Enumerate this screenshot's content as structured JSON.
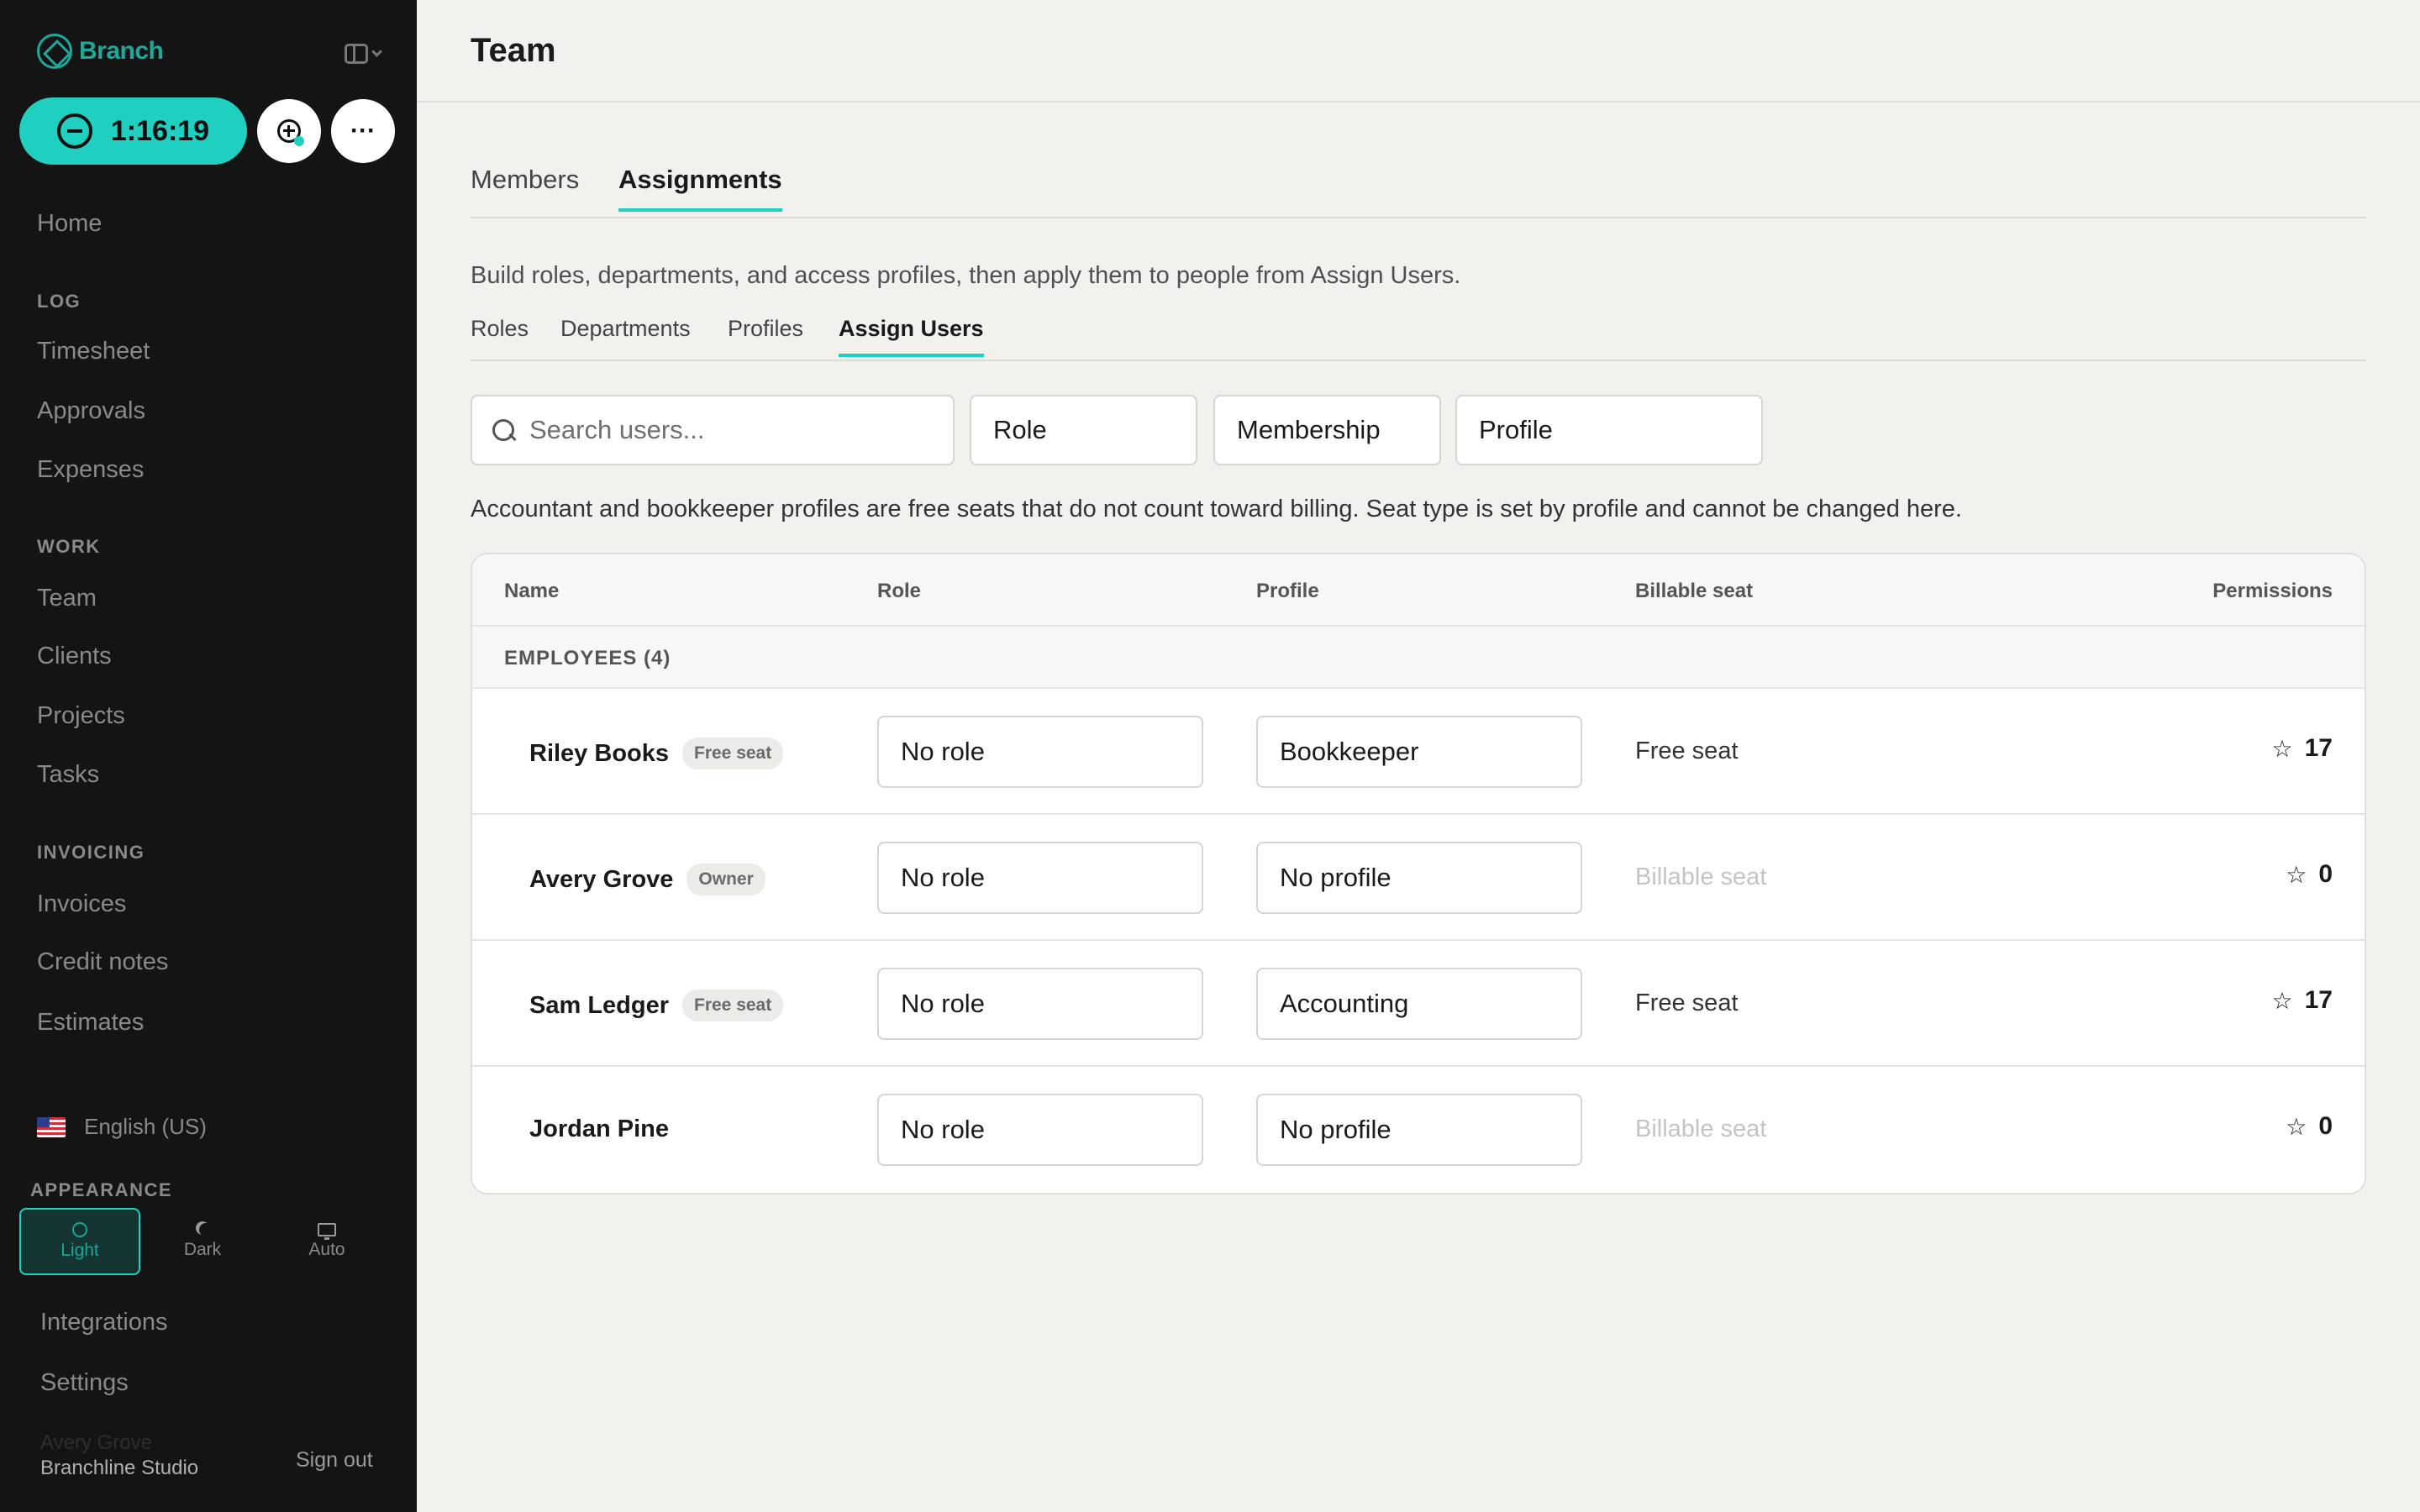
{
  "sidebar": {
    "logo_text": "Branch",
    "timer": "1:16:19",
    "more_label": "···",
    "nav_home": "Home",
    "sections": {
      "log": "LOG",
      "work": "WORK",
      "invoicing": "INVOICING",
      "appearance": "APPEARANCE"
    },
    "log_items": [
      "Timesheet",
      "Approvals",
      "Expenses"
    ],
    "work_items": [
      "Team",
      "Clients",
      "Projects",
      "Tasks"
    ],
    "invoicing_items": [
      "Invoices",
      "Credit notes",
      "Estimates"
    ],
    "language": "English (US)",
    "appearance_options": [
      "Light",
      "Dark",
      "Auto"
    ],
    "appearance_selected": "Light",
    "bottom_items": [
      "Integrations",
      "Settings"
    ],
    "user_name": "Avery Grove",
    "org_name": "Branchline Studio",
    "sign_out": "Sign out"
  },
  "header": {
    "title": "Team"
  },
  "tabs": [
    "Members",
    "Assignments"
  ],
  "active_tab": "Assignments",
  "intro": "Build roles, departments, and access profiles, then apply them to people from Assign Users.",
  "subtabs": [
    "Roles",
    "Departments",
    "Profiles",
    "Assign Users"
  ],
  "active_subtab": "Assign Users",
  "filters": {
    "search_placeholder": "Search users...",
    "role": "Role",
    "membership": "Membership",
    "profile": "Profile"
  },
  "note": "Accountant and bookkeeper profiles are free seats that do not count toward billing. Seat type is set by profile and cannot be changed here.",
  "table": {
    "columns": [
      "Name",
      "Role",
      "Profile",
      "Billable seat",
      "Permissions"
    ],
    "group_label": "EMPLOYEES (4)",
    "rows": [
      {
        "name": "Riley Books",
        "badge": "Free seat",
        "role": "No role",
        "profile": "Bookkeeper",
        "seat": "Free seat",
        "permissions": "17"
      },
      {
        "name": "Avery Grove",
        "badge": "Owner",
        "role": "No role",
        "profile": "No profile",
        "seat": "Billable seat",
        "permissions": "0"
      },
      {
        "name": "Sam Ledger",
        "badge": "Free seat",
        "role": "No role",
        "profile": "Accounting",
        "seat": "Free seat",
        "permissions": "17"
      },
      {
        "name": "Jordan Pine",
        "badge": "",
        "role": "No role",
        "profile": "No profile",
        "seat": "Billable seat",
        "permissions": "0"
      }
    ]
  },
  "colors": {
    "accent": "#1fd0c0",
    "sidebar_bg": "#141414",
    "page_bg": "#f2f1ed",
    "brand": "#1fa89a"
  }
}
